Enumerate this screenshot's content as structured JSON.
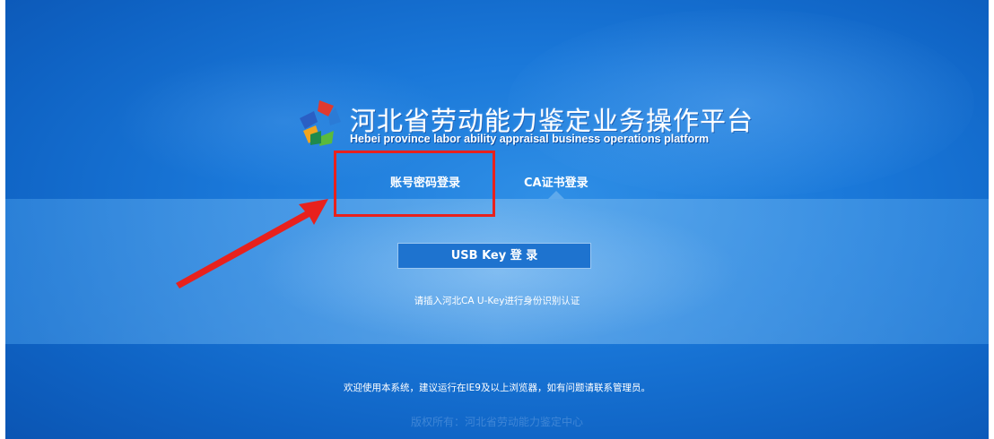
{
  "header": {
    "title_cn": "河北省劳动能力鉴定业务操作平台",
    "title_en": "Hebei province labor ability appraisal business operations platform",
    "logo": "pinwheel-logo-icon"
  },
  "tabs": [
    {
      "label": "账号密码登录"
    },
    {
      "label": "CA证书登录",
      "active": true
    }
  ],
  "login": {
    "usb_button_label": "USB Key 登 录",
    "hint": "请插入河北CA U-Key进行身份识别认证"
  },
  "footer": {
    "note": "欢迎使用本系统，建议运行在IE9及以上浏览器，如有问题请联系管理员。",
    "copyright": "版权所有：河北省劳动能力鉴定中心"
  },
  "annotations": {
    "highlight_color": "#e8211d",
    "arrow_color": "#e8211d"
  },
  "colors": {
    "background": "#1a78d9",
    "button": "#1e73cf"
  }
}
